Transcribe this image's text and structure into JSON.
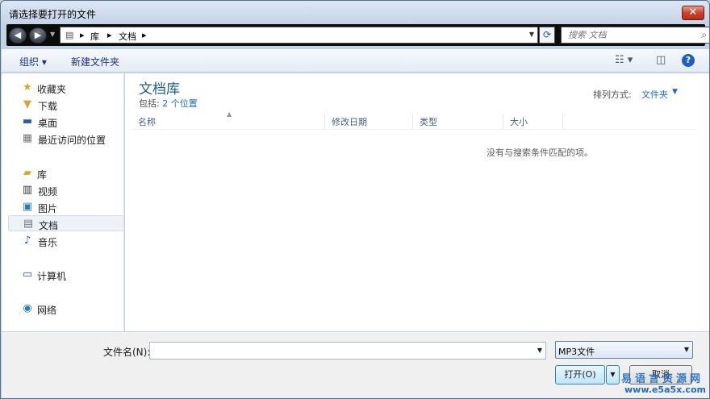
{
  "window": {
    "title": "请选择要打开的文件",
    "close_label": "✕"
  },
  "navigation": {
    "back_glyph": "◀",
    "forward_glyph": "▶",
    "breadcrumb": [
      "库",
      "文档"
    ],
    "crumb_separator": "▸",
    "search_placeholder": "搜索 文档"
  },
  "toolbar": {
    "organize_label": "组织",
    "new_folder_label": "新建文件夹",
    "help_label": "?"
  },
  "sidebar": {
    "favorites": {
      "label": "收藏夹",
      "icon": "star-icon"
    },
    "favorites_items": [
      {
        "label": "下载",
        "icon": "download-folder-icon"
      },
      {
        "label": "桌面",
        "icon": "desktop-icon"
      },
      {
        "label": "最近访问的位置",
        "icon": "recent-places-icon"
      }
    ],
    "libraries": {
      "label": "库",
      "icon": "library-icon"
    },
    "library_items": [
      {
        "label": "视频",
        "icon": "video-icon"
      },
      {
        "label": "图片",
        "icon": "pictures-icon"
      },
      {
        "label": "文档",
        "icon": "documents-icon",
        "selected": true
      },
      {
        "label": "音乐",
        "icon": "music-icon"
      }
    ],
    "computer": {
      "label": "计算机",
      "icon": "computer-icon"
    },
    "network": {
      "label": "网络",
      "icon": "network-icon"
    }
  },
  "content": {
    "library_title": "文档库",
    "includes_prefix": "包括:",
    "includes_link": "2 个位置",
    "arrange_label": "排列方式:",
    "arrange_value": "文件夹",
    "columns": [
      "名称",
      "修改日期",
      "类型",
      "大小"
    ],
    "empty_message": "没有与搜索条件匹配的项。"
  },
  "footer": {
    "filename_label": "文件名(N):",
    "filename_value": "",
    "filetype_value": "MP3文件",
    "open_label": "打开(O)",
    "cancel_label": "取消",
    "watermark_line1": "易语言资源网",
    "watermark_line2": "www.e5a5x.com"
  },
  "colors": {
    "accent": "#1f6cbf",
    "title_blue": "#1e5d8a",
    "close_red": "#c9432c"
  }
}
